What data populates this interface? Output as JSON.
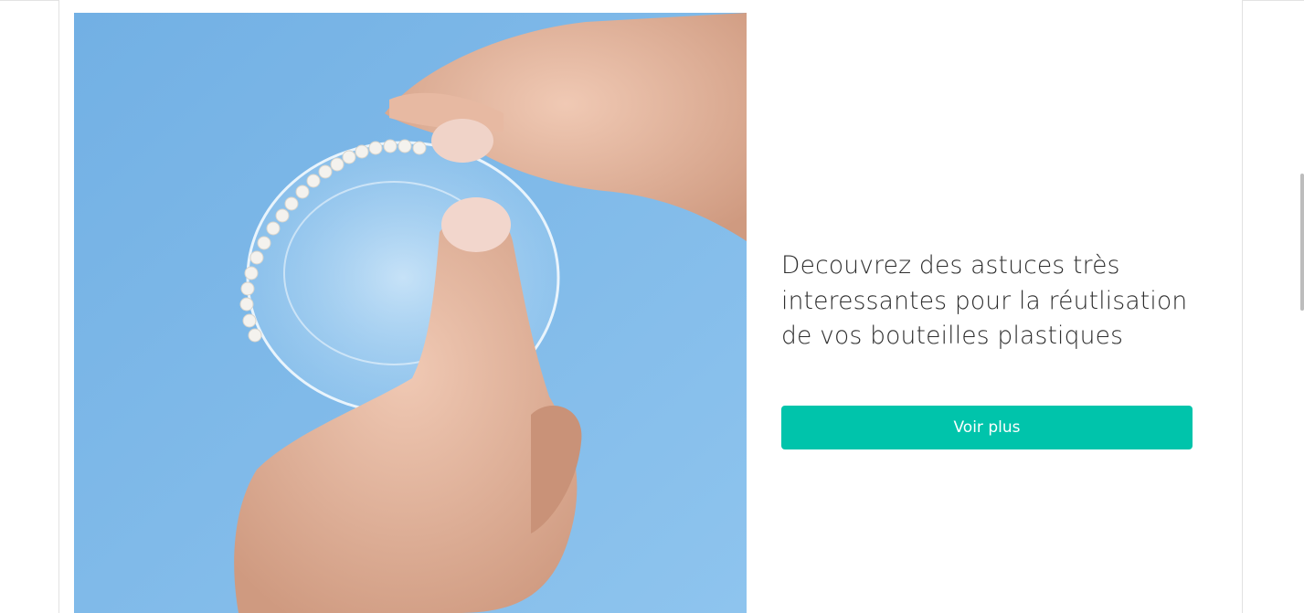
{
  "article": {
    "headline": "Decouvrez des astuces très interessantes pour la réutlisation de vos bouteilles plastiques",
    "cta_label": "Voir plus"
  },
  "colors": {
    "accent": "#00c4ab",
    "image_background": "#7ab7e6",
    "text": "#2d2d2d"
  },
  "icons": {
    "media": "photo-hands-plastic-bottle-pearls"
  }
}
